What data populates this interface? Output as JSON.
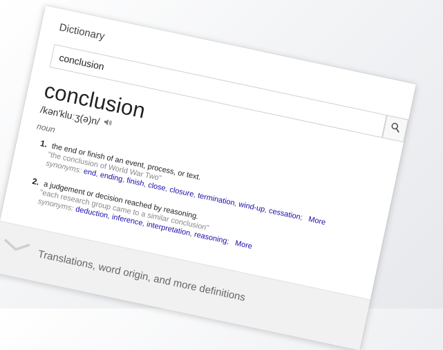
{
  "card": {
    "title": "Dictionary",
    "search": {
      "value": "conclusion"
    }
  },
  "entry": {
    "word": "conclusion",
    "phonetic": "/kən'kluːʒ(ə)n/",
    "part_of_speech": "noun",
    "senses": [
      {
        "number": "1.",
        "definition": "the end or finish of an event, process, or text.",
        "example": "\"the conclusion of World War Two\"",
        "synonyms_label": "synonyms:",
        "synonyms": [
          "end",
          "ending",
          "finish",
          "close",
          "closure",
          "termination",
          "wind-up",
          "cessation"
        ],
        "more": "More"
      },
      {
        "number": "2.",
        "definition": "a judgement or decision reached by reasoning.",
        "example": "\"each research group came to a similar conclusion\"",
        "synonyms_label": "synonyms:",
        "synonyms": [
          "deduction",
          "inference",
          "interpretation",
          "reasoning"
        ],
        "more": "More"
      }
    ]
  },
  "footer": {
    "text": "Translations, word origin, and more definitions",
    "icon": "chevron-down-icon"
  },
  "icons": {
    "search": "search-icon",
    "audio": "speaker-icon"
  }
}
